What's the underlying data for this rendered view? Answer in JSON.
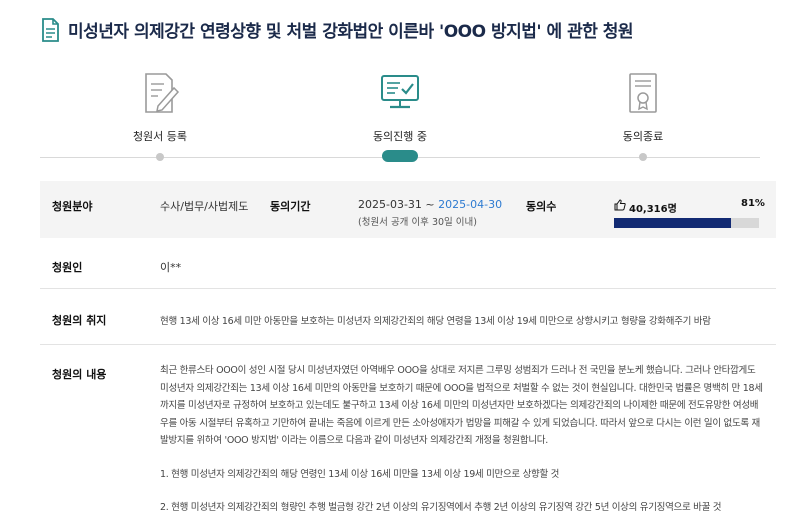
{
  "header": {
    "title": "미성년자 의제강간 연령상향 및 처벌 강화법안 이른바 'OOO 방지법' 에 관한 청원"
  },
  "steps": [
    {
      "label": "청원서 등록",
      "icon": "document-edit-icon"
    },
    {
      "label": "동의진행 중",
      "icon": "monitor-check-icon"
    },
    {
      "label": "동의종료",
      "icon": "certificate-icon"
    }
  ],
  "info": {
    "field_label": "청원분야",
    "field_value": "수사/법무/사법제도",
    "period_label": "동의기간",
    "period_start": "2025-03-31",
    "period_sep": " ~ ",
    "period_end": "2025-04-30",
    "period_note": "(청원서 공개 이후 30일 이내)",
    "count_label": "동의수",
    "count_value": "40,316명",
    "percent_text": "81%",
    "percent": 81
  },
  "petitioner": {
    "label": "청원인",
    "value": "이**"
  },
  "purpose": {
    "label": "청원의 취지",
    "value": "현행 13세 이상 16세 미만 아동만을 보호하는 미성년자 의제강간죄의 해당 연령을 13세 이상 19세 미만으로 상향시키고 형량을 강화해주기 바람"
  },
  "content": {
    "label": "청원의 내용",
    "lines": [
      "최근 한류스타 OOO이 성인 시절 당시 미성년자였던 아역배우 OOO을 상대로 저지른 그루밍 성범죄가 드러나 전 국민을 분노케 했습니다. 그러나 안타깝게도",
      "미성년자 의제강간죄는 13세 이상 16세 미만의 아동만을 보호하기 때문에 OOO을 법적으로 처벌할 수 없는 것이 현실입니다. 대한민국 법률은 명백히 만 18세",
      "까지를 미성년자로 규정하여 보호하고 있는데도 불구하고 13세 이상 16세 미만의 미성년자만 보호하겠다는 의제강간죄의 나이제한 때문에 전도유망한 여성배",
      "우를 아동 시절부터 유혹하고 기만하여 끝내는 죽음에 이르게 만든 소아성애자가 법망을 피해갈 수 있게 되었습니다. 따라서 앞으로 다시는 이런 일이 없도록 재",
      "발방지를 위하여 'OOO 방지법' 이라는 이름으로 다음과 같이 미성년자 의제강간죄 개정을 청원합니다."
    ],
    "item1": "1. 현행 미성년자 의제강간죄의 해당 연령인 13세 이상 16세 미만을 13세 이상 19세 미만으로 상향할 것",
    "item2": "2. 현행 미성년자 의제강간죄의 형량인 추행 벌금형 강간 2년 이상의 유기징역에서 추행 2년 이상의 유기징역 강간 5년 이상의 유기징역으로 바꿀 것"
  },
  "colors": {
    "accent": "#2a8c8a",
    "bar": "#122a73",
    "end_date": "#2e7bd1"
  }
}
